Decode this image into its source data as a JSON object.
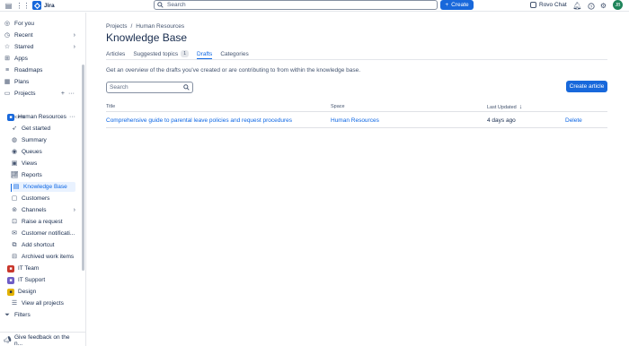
{
  "topbar": {
    "app_name": "Jira",
    "search_placeholder": "Search",
    "create_label": "Create",
    "rovo_label": "Rovo Chat",
    "avatar_initials": "JB"
  },
  "sidebar": {
    "for_you": "For you",
    "recent": "Recent",
    "starred": "Starred",
    "apps": "Apps",
    "roadmaps": "Roadmaps",
    "plans": "Plans",
    "projects": "Projects",
    "recent_section": "Recent",
    "project_name": "Human Resources",
    "sub_items": [
      "Get started",
      "Summary",
      "Queues",
      "Views",
      "Reports",
      "Knowledge Base",
      "Customers",
      "Channels",
      "Raise a request",
      "Customer notificati...",
      "Add shortcut",
      "Archived work items"
    ],
    "other_projects": [
      "IT Team",
      "IT Support",
      "Design"
    ],
    "view_all": "View all projects",
    "filters": "Filters",
    "feedback": "Give feedback on the n..."
  },
  "main": {
    "breadcrumb": [
      "Projects",
      "/",
      "Human Resources"
    ],
    "title": "Knowledge Base",
    "tabs": [
      {
        "label": "Articles"
      },
      {
        "label": "Suggested topics",
        "count": "1"
      },
      {
        "label": "Drafts"
      },
      {
        "label": "Categories"
      }
    ],
    "description": "Get an overview of the drafts you've created or are contributing to from within the knowledge base.",
    "search_placeholder": "Search",
    "create_article": "Create article",
    "columns": [
      "Title",
      "Space",
      "Last Updated"
    ],
    "rows": [
      {
        "title": "Comprehensive guide to parental leave policies and request procedures",
        "space": "Human Resources",
        "updated": "4 days ago",
        "action": "Delete"
      }
    ]
  },
  "colors": {
    "accent": "#1868db",
    "link": "#0c66e4",
    "active_bg": "#e9f2ff"
  }
}
